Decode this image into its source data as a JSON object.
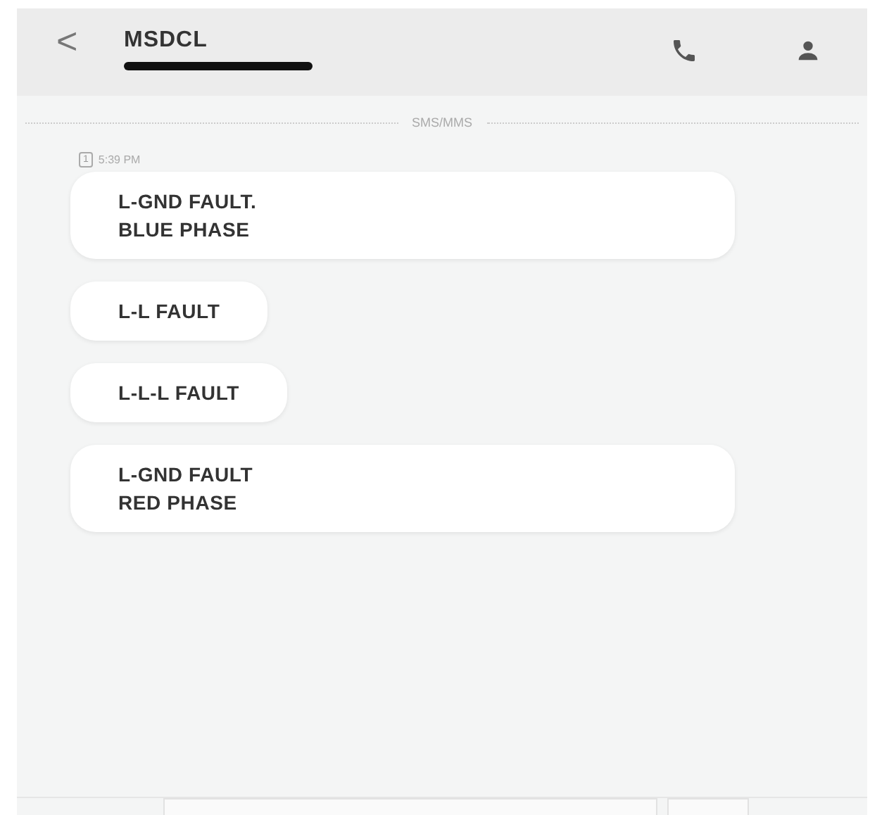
{
  "header": {
    "back": "<",
    "title": "MSDCL"
  },
  "divider_label": "SMS/MMS",
  "timestamp": {
    "sim": "1",
    "time": "5:39 PM"
  },
  "messages": [
    {
      "text": "L-GND FAULT.\nBLUE PHASE",
      "wide": true
    },
    {
      "text": "L-L FAULT",
      "wide": false
    },
    {
      "text": "L-L-L FAULT",
      "wide": false
    },
    {
      "text": "L-GND FAULT\nRED PHASE",
      "wide": true
    }
  ]
}
